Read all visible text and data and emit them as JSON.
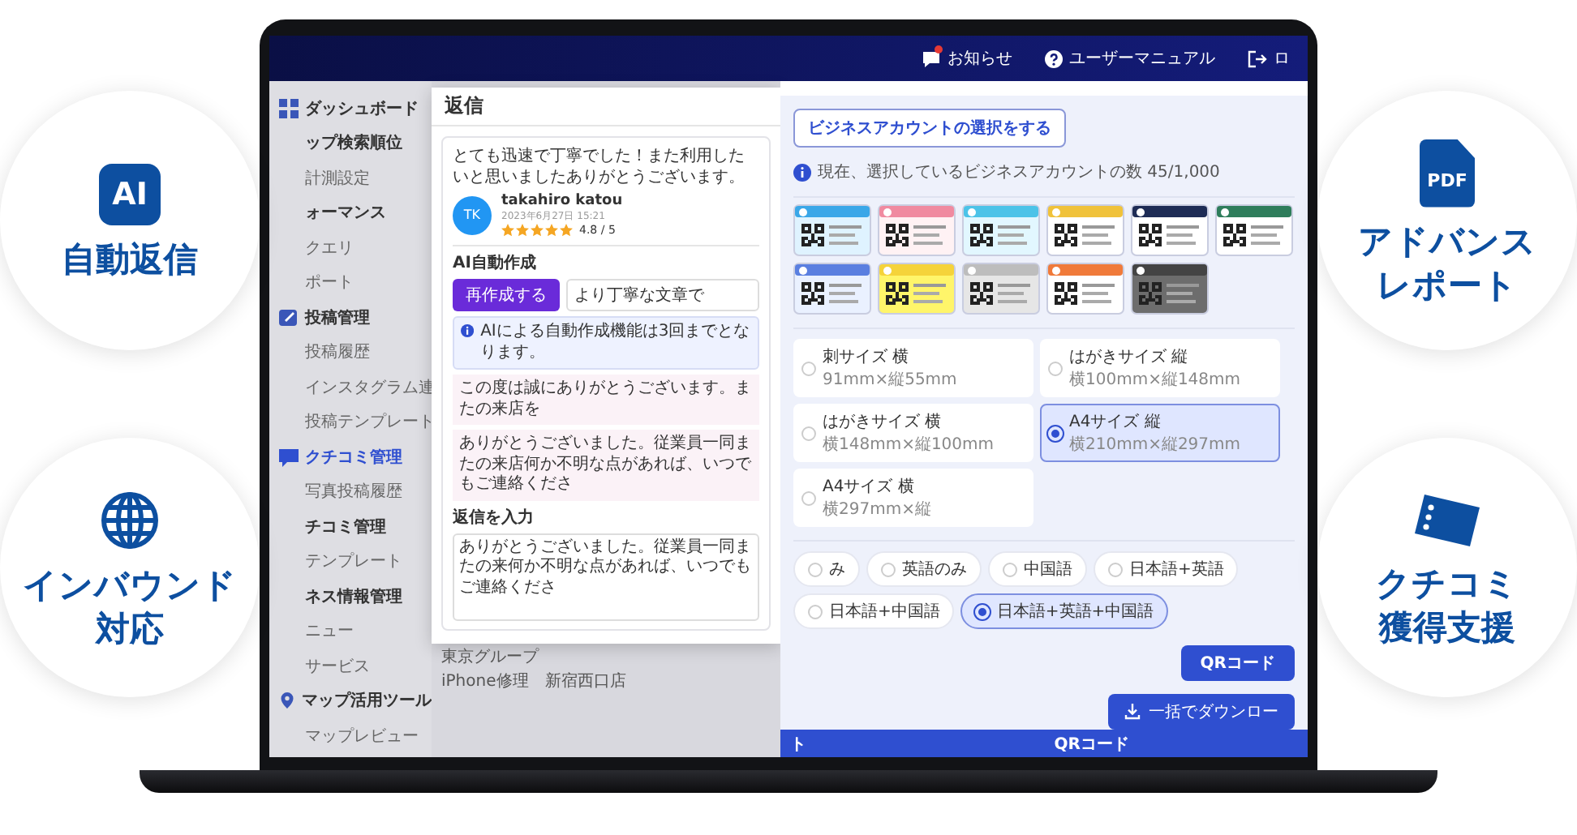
{
  "features": [
    {
      "kind": "ai",
      "badge": "AI",
      "lines": [
        "自動返信"
      ]
    },
    {
      "kind": "globe",
      "lines": [
        "インバウンド",
        "対応"
      ]
    },
    {
      "kind": "pdf",
      "badge": "PDF",
      "lines": [
        "アドバンス",
        "レポート"
      ]
    },
    {
      "kind": "ticket",
      "lines": [
        "クチコミ",
        "獲得支援"
      ]
    }
  ],
  "topbar": {
    "items": [
      {
        "kind": "notice",
        "label": "お知らせ",
        "unread": true
      },
      {
        "kind": "help",
        "label": "ユーザーマニュアル",
        "unread": false
      },
      {
        "kind": "logout",
        "label": "ロ",
        "unread": false
      }
    ]
  },
  "sidebar": {
    "items": [
      {
        "kind": "heading",
        "label": "ダッシュボード",
        "selected": false
      },
      {
        "kind": "heading",
        "label": "ップ検索順位",
        "selected": false
      },
      {
        "kind": "link",
        "label": "計測設定",
        "selected": false
      },
      {
        "kind": "heading",
        "label": "ォーマンス",
        "selected": false
      },
      {
        "kind": "link",
        "label": "クエリ",
        "selected": false
      },
      {
        "kind": "link",
        "label": "ポート",
        "selected": false
      },
      {
        "kind": "heading",
        "label": "投稿管理",
        "selected": false
      },
      {
        "kind": "link",
        "label": "投稿履歴",
        "selected": false
      },
      {
        "kind": "link",
        "label": "インスタグラム連",
        "selected": false
      },
      {
        "kind": "link",
        "label": "投稿テンプレート",
        "selected": false
      },
      {
        "kind": "heading",
        "label": "クチコミ管理",
        "selected": true
      },
      {
        "kind": "link",
        "label": "写真投稿履歴",
        "selected": false
      },
      {
        "kind": "heading",
        "label": "チコミ管理",
        "selected": false
      },
      {
        "kind": "link",
        "label": "テンプレート",
        "selected": false
      },
      {
        "kind": "heading",
        "label": "ネス情報管理",
        "selected": false
      },
      {
        "kind": "link",
        "label": "ニュー",
        "selected": false
      },
      {
        "kind": "link",
        "label": "サービス",
        "selected": false
      },
      {
        "kind": "heading",
        "label": "マップ活用ツール",
        "selected": false
      },
      {
        "kind": "link",
        "label": "マップレビュー",
        "selected": false
      }
    ]
  },
  "modal": {
    "title": "返信",
    "review": {
      "text": "とても迅速で丁寧でした！また利用したいと思いましたありがとうございます。",
      "initials": "TK",
      "name": "takahiro katou",
      "date": "2023年6月27日 15:21",
      "stars": 5,
      "rating": "4.8 / 5"
    },
    "ai": {
      "label": "AI自動作成",
      "button": "再作成する",
      "value": "より丁寧な文章で",
      "notice": "AIによる自動作成機能は3回までとなります。",
      "suggestions": [
        "この度は誠にありがとうございます。またの来店を",
        "ありがとうございました。従業員一同またの来店何か不明な点があれば、いつでもご連絡くださ"
      ]
    },
    "reply": {
      "label": "返信を入力",
      "value": "ありがとうございました。従業員一同またの来何か不明な点があれば、いつでもご連絡くださ"
    },
    "group": "東京グループ",
    "store": "iPhone修理　新宿西口店"
  },
  "main": {
    "account_button": "ビジネスアカウントの選択をする",
    "account_info": "現在、選択しているビジネスアカウントの数 45/1,000",
    "sizes": [
      {
        "label": "刺サイズ 横",
        "dims": "91mm×縦55mm",
        "selected": false
      },
      {
        "label": "はがきサイズ 縦",
        "dims": "横100mm×縦148mm",
        "selected": false
      },
      {
        "label": "はがきサイズ 横",
        "dims": "横148mm×縦100mm",
        "selected": false
      },
      {
        "label": "A4サイズ 縦",
        "dims": "横210mm×縦297mm",
        "selected": true
      },
      {
        "label": "A4サイズ 横",
        "dims": "横297mm×縦",
        "selected": false
      }
    ],
    "languages": [
      {
        "label": "み",
        "selected": false
      },
      {
        "label": "英語のみ",
        "selected": false
      },
      {
        "label": "中国語",
        "selected": false
      },
      {
        "label": "日本語+英語",
        "selected": false
      },
      {
        "label": "日本語+中国語",
        "selected": false
      },
      {
        "label": "日本語+英語+中国語",
        "selected": true
      }
    ],
    "qr_button": "QRコード",
    "download_button": "一括でダウンロー",
    "bottom_bar": [
      "ト",
      "QRコード"
    ]
  }
}
